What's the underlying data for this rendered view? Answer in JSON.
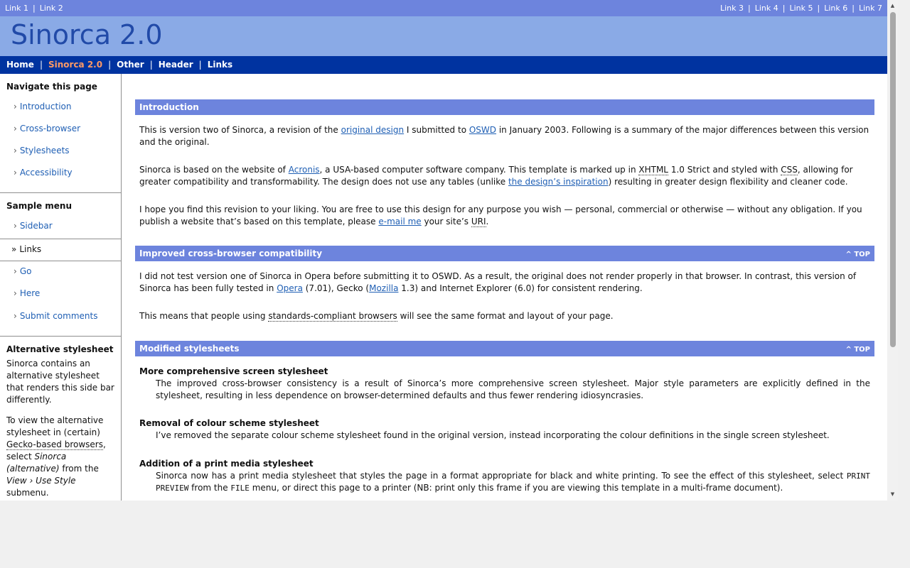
{
  "topbar": {
    "left_links": [
      "Link 1",
      "Link 2"
    ],
    "right_links": [
      "Link 3",
      "Link 4",
      "Link 5",
      "Link 6",
      "Link 7"
    ],
    "sep": "|"
  },
  "header": {
    "title": "Sinorca 2.0"
  },
  "mainnav": {
    "items": [
      "Home",
      "Sinorca 2.0",
      "Other",
      "Header",
      "Links"
    ],
    "active": "Sinorca 2.0",
    "sep": "|"
  },
  "sidebar": {
    "nav_title": "Navigate this page",
    "nav_items": [
      "Introduction",
      "Cross-browser",
      "Stylesheets",
      "Accessibility"
    ],
    "menu_title": "Sample menu",
    "menu_items": [
      "Sidebar",
      "Links",
      "Go",
      "Here",
      "Submit comments"
    ],
    "arrow": "›",
    "active_arrow": "»",
    "alt_title": "Alternative stylesheet",
    "alt_text1": "Sinorca contains an alternative stylesheet that renders this side bar differently.",
    "alt_text2_a": "To view the alternative stylesheet in (certain)",
    "alt_text2_link": "Gecko-based browsers",
    "alt_text2_b": ", select",
    "alt_text2_em1": "Sinorca (alternative)",
    "alt_text2_c": "from the",
    "alt_text2_em2": "View › Use Style",
    "alt_text2_d": "submenu."
  },
  "sections": {
    "intro": {
      "title": "Introduction",
      "p1_a": "This is version two of Sinorca, a revision of the ",
      "p1_link1": "original design",
      "p1_b": " I submitted to ",
      "p1_link2": "OSWD",
      "p1_c": " in January 2003. Following is a summary of the major differences between this version and the original.",
      "p2_a": "Sinorca is based on the website of ",
      "p2_link1": "Acronis",
      "p2_b": ", a USA-based computer software company. This template is marked up in ",
      "p2_abbr1": "XHTML",
      "p2_c": " 1.0 Strict and styled with ",
      "p2_abbr2": "CSS",
      "p2_d": ", allowing for greater compatibility and transformability. The design does not use any tables (unlike ",
      "p2_link2": "the design’s inspiration",
      "p2_e": ") resulting in greater design flexibility and cleaner code.",
      "p3_a": "I hope you find this revision to your liking. You are free to use this design for any purpose you wish — personal, commercial or otherwise — without any obligation. If you publish a website that’s based on this template, please ",
      "p3_link": "e-mail me",
      "p3_b": " your site’s ",
      "p3_abbr": "URI",
      "p3_c": "."
    },
    "cross": {
      "title": "Improved cross-browser compatibility",
      "top": "^ TOP",
      "p1_a": "I did not test version one of Sinorca in Opera before submitting it to OSWD. As a result, the original does not render properly in that browser. In contrast, this version of Sinorca has been fully tested in ",
      "p1_link1": "Opera",
      "p1_b": " (7.01), Gecko (",
      "p1_link2": "Mozilla",
      "p1_c": " 1.3) and Internet Explorer (6.0) for consistent rendering.",
      "p2_a": "This means that people using ",
      "p2_abbr": "standards-compliant browsers",
      "p2_b": " will see the same format and layout of your page."
    },
    "styles": {
      "title": "Modified stylesheets",
      "top": "^ TOP",
      "dt1": "More comprehensive screen stylesheet",
      "dd1": "The improved cross-browser consistency is a result of Sinorca’s more comprehensive screen stylesheet. Major style parameters are explicitly defined in the stylesheet, resulting in less dependence on browser-determined defaults and thus fewer rendering idiosyncrasies.",
      "dt2": "Removal of colour scheme stylesheet",
      "dd2": "I’ve removed the separate colour scheme stylesheet found in the original version, instead incorporating the colour definitions in the single screen stylesheet.",
      "dt3": "Addition of a print media stylesheet",
      "dd3_a": "Sinorca now has a print media stylesheet that styles the page in a format appropriate for black and white printing. To see the effect of this stylesheet, select ",
      "dd3_mono1": "PRINT PREVIEW",
      "dd3_b": " from the ",
      "dd3_mono2": "FILE",
      "dd3_c": " menu, or direct this page to a printer (NB: print only this frame if you are viewing this template in a multi-frame document)."
    }
  },
  "scrollbar": {
    "up": "▲",
    "down": "▼"
  },
  "colors": {
    "bar": "#6d84dd",
    "header": "#8aaae6",
    "nav": "#0033a0",
    "title": "#214aa8",
    "active": "#ff9a66",
    "link": "#1f5fb4"
  }
}
